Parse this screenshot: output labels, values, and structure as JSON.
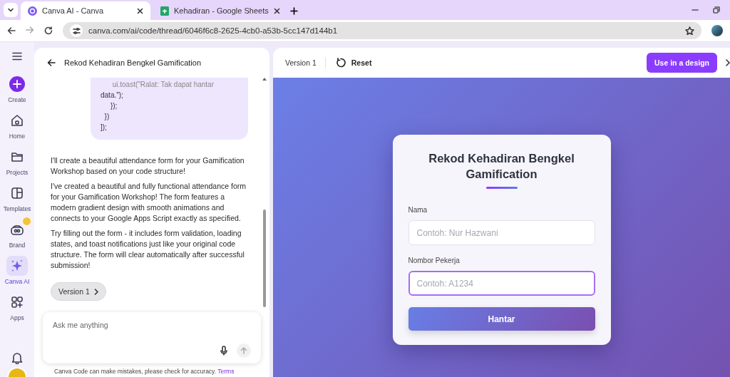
{
  "browser": {
    "tabs": [
      {
        "title": "Canva AI - Canva",
        "kind": "canva",
        "selected": true
      },
      {
        "title": "Kehadiran - Google Sheets",
        "kind": "sheets",
        "selected": false
      }
    ],
    "url": "canva.com/ai/code/thread/6046f6c8-2625-4cb0-a53b-5cc147d144b1"
  },
  "sidebar": {
    "items": [
      {
        "label": "Create",
        "kind": "create",
        "selected": false,
        "badge": false
      },
      {
        "label": "Home",
        "kind": "home",
        "selected": false,
        "badge": false
      },
      {
        "label": "Projects",
        "kind": "projects",
        "selected": false,
        "badge": false
      },
      {
        "label": "Templates",
        "kind": "templates",
        "selected": false,
        "badge": false
      },
      {
        "label": "Brand",
        "kind": "brand",
        "selected": false,
        "badge": true
      },
      {
        "label": "Canva AI",
        "kind": "ai",
        "selected": true,
        "badge": false
      },
      {
        "label": "Apps",
        "kind": "apps",
        "selected": false,
        "badge": false
      }
    ]
  },
  "chat": {
    "title": "Rekod Kehadiran Bengkel Gamification",
    "code_lines": [
      "      ui.toast(\"Ralat: Tak dapat hantar",
      "data.\");",
      "     });",
      "  })",
      "]);"
    ],
    "messages": [
      "I'll create a beautiful attendance form for your Gamification Workshop based on your code structure!",
      "I've created a beautiful and fully functional attendance form for your Gamification Workshop! The form features a modern gradient design with smooth animations and connects to your Google Apps Script exactly as specified.",
      "Try filling out the form - it includes form validation, loading states, and toast notifications just like your original code structure. The form will clear automatically after successful submission!"
    ],
    "version_button": "Version 1",
    "input": {
      "placeholder": "Ask me anything"
    },
    "disclaimer": "Canva Code can make mistakes, please check for accuracy.",
    "terms_link": "Terms"
  },
  "preview": {
    "version": "Version 1",
    "reset": "Reset",
    "use_button": "Use in a design",
    "form": {
      "title": "Rekod Kehadiran Bengkel Gamification",
      "fields": [
        {
          "label": "Nama",
          "placeholder": "Contoh: Nur Hazwani",
          "focused": false
        },
        {
          "label": "Nombor Pekerja",
          "placeholder": "Contoh: A1234",
          "focused": true
        }
      ],
      "submit": "Hantar"
    }
  }
}
